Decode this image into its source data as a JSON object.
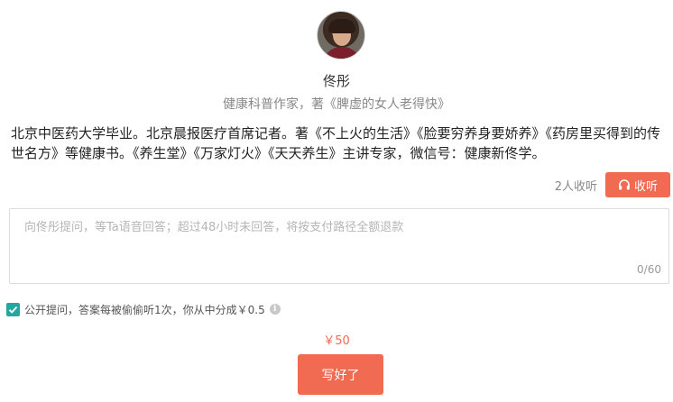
{
  "expert": {
    "avatar_icon": "portrait-photo",
    "name": "佟彤",
    "subtitle": "健康科普作家，著《脾虚的女人老得快》",
    "bio": "北京中医药大学毕业。北京晨报医疗首席记者。著《不上火的生活》《脸要穷养身要娇养》《药房里买得到的传世名方》等健康书。《养生堂》《万家灯火》《天天养生》主讲专家，微信号：健康新佟学。"
  },
  "listen": {
    "count_text": "2人收听",
    "button_label": "收听",
    "button_icon": "headphones-icon"
  },
  "question": {
    "placeholder": "向佟彤提问，等Ta语音回答；超过48小时未回答，将按支付路径全额退款",
    "value": "",
    "char_count": "0/60"
  },
  "public_option": {
    "checked": true,
    "label": "公开提问，答案每被偷偷听1次，你从中分成￥0.5",
    "info_icon": "info-icon"
  },
  "price": "￥50",
  "submit_label": "写好了",
  "colors": {
    "accent": "#f06b52",
    "checkbox": "#23a8a0",
    "muted_text": "#888888"
  }
}
